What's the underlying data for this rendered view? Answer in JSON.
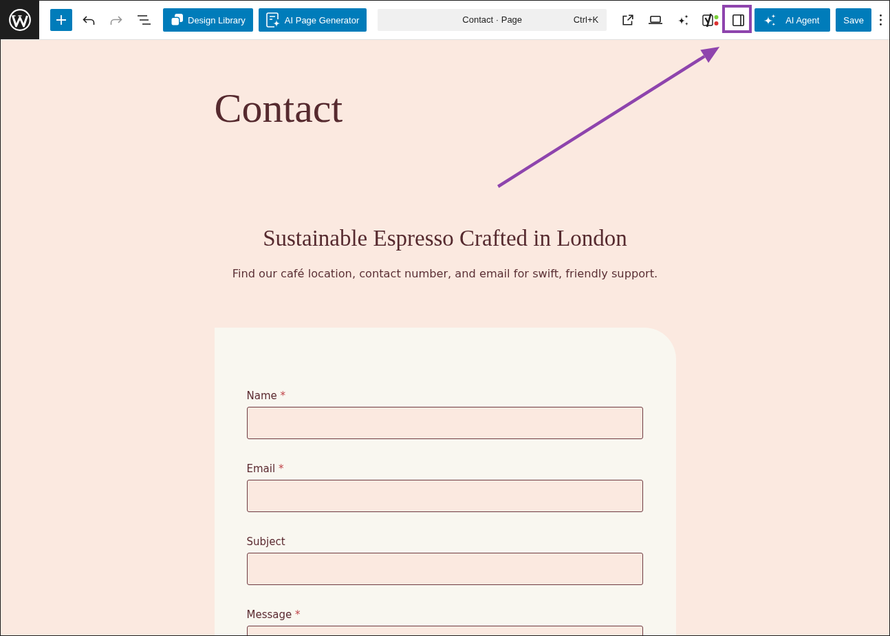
{
  "toolbar": {
    "left_tools": [
      {
        "kind": "inserter",
        "disabled": false
      },
      {
        "kind": "undo",
        "disabled": false
      },
      {
        "kind": "redo",
        "disabled": true
      },
      {
        "kind": "list_view",
        "disabled": false
      }
    ],
    "actions": [
      {
        "kind": "design_library",
        "label": "Design Library"
      },
      {
        "kind": "page_generator",
        "label": "AI Page Generator"
      }
    ],
    "command_bar": {
      "title": "Contact · Page",
      "shortcut": "Ctrl+K"
    },
    "right_tools": [
      {
        "kind": "view_page",
        "highlighted": false
      },
      {
        "kind": "preview",
        "highlighted": false
      },
      {
        "kind": "ai_tools",
        "highlighted": false
      },
      {
        "kind": "seo",
        "highlighted": false
      },
      {
        "kind": "settings_sidebar",
        "highlighted": true
      }
    ],
    "ai_agent": {
      "label": "AI Agent"
    },
    "save": {
      "label": "Save"
    }
  },
  "page": {
    "title": "Contact",
    "tagline": "Sustainable Espresso Crafted in London",
    "intro": "Find our café location, contact number, and email for swift, friendly support."
  },
  "form": {
    "required_marker": "*",
    "fields": [
      {
        "kind": "input",
        "label": "Name",
        "required": true
      },
      {
        "kind": "input",
        "label": "Email",
        "required": true
      },
      {
        "kind": "input",
        "label": "Subject",
        "required": false
      },
      {
        "kind": "textarea",
        "label": "Message",
        "required": true
      }
    ]
  }
}
